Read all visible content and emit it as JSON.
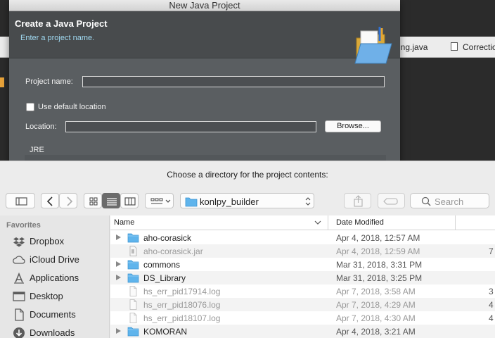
{
  "ide": {
    "tabs": [
      {
        "label": "ing.java"
      },
      {
        "label": "Correctio"
      }
    ]
  },
  "dialog": {
    "window_title": "New Java Project",
    "heading": "Create a Java Project",
    "subheading": "Enter a project name.",
    "project_name_label": "Project name:",
    "project_name_value": "",
    "use_default_label": "Use default location",
    "use_default_checked": false,
    "location_label": "Location:",
    "location_value": "",
    "browse_label": "Browse...",
    "jre_label": "JRE"
  },
  "finder": {
    "title": "Choose a directory for the project contents:",
    "current_folder": "konlpy_builder",
    "search_placeholder": "Search",
    "view_mode": "list",
    "sidebar": {
      "heading": "Favorites",
      "items": [
        {
          "label": "Dropbox",
          "icon": "dropbox-icon"
        },
        {
          "label": "iCloud Drive",
          "icon": "cloud-icon"
        },
        {
          "label": "Applications",
          "icon": "applications-icon"
        },
        {
          "label": "Desktop",
          "icon": "desktop-icon"
        },
        {
          "label": "Documents",
          "icon": "documents-icon"
        },
        {
          "label": "Downloads",
          "icon": "downloads-icon"
        }
      ]
    },
    "columns": {
      "name": "Name",
      "date": "Date Modified"
    },
    "files": [
      {
        "name": "aho-corasick",
        "date": "Apr 4, 2018, 12:57 AM",
        "type": "folder",
        "enabled": true,
        "extra": ""
      },
      {
        "name": "aho-corasick.jar",
        "date": "Apr 4, 2018, 12:59 AM",
        "type": "jar",
        "enabled": false,
        "extra": "7"
      },
      {
        "name": "commons",
        "date": "Mar 31, 2018, 3:31 PM",
        "type": "folder",
        "enabled": true,
        "extra": ""
      },
      {
        "name": "DS_Library",
        "date": "Mar 31, 2018, 3:25 PM",
        "type": "folder",
        "enabled": true,
        "extra": ""
      },
      {
        "name": "hs_err_pid17914.log",
        "date": "Apr 7, 2018, 3:58 AM",
        "type": "file",
        "enabled": false,
        "extra": "3"
      },
      {
        "name": "hs_err_pid18076.log",
        "date": "Apr 7, 2018, 4:29 AM",
        "type": "file",
        "enabled": false,
        "extra": "4"
      },
      {
        "name": "hs_err_pid18107.log",
        "date": "Apr 7, 2018, 4:30 AM",
        "type": "file",
        "enabled": false,
        "extra": "4"
      },
      {
        "name": "KOMORAN",
        "date": "Apr 4, 2018, 3:21 AM",
        "type": "folder",
        "enabled": true,
        "extra": ""
      }
    ]
  },
  "colors": {
    "folder": "#5fb4ec",
    "dialog_bg": "#5a5e61",
    "subheading": "#9fd8f0"
  }
}
